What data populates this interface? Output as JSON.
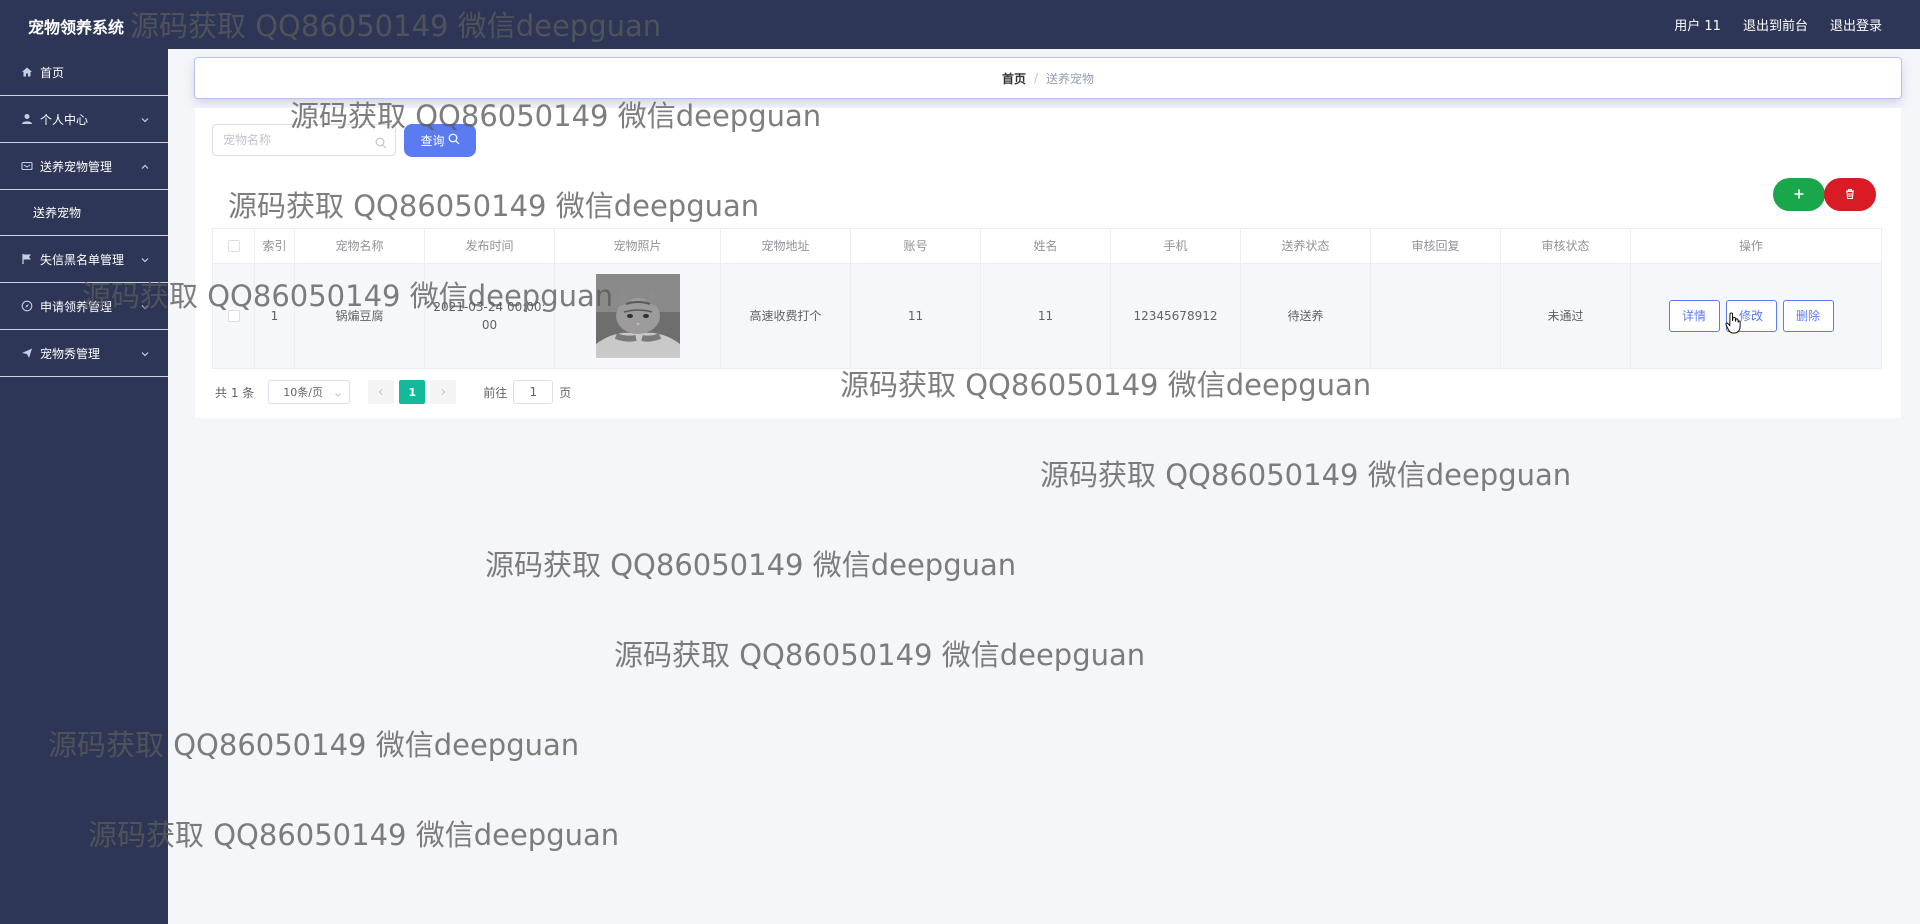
{
  "header": {
    "app_title": "宠物领养系统",
    "user_label": "用户 11",
    "to_front_label": "退出到前台",
    "logout_label": "退出登录"
  },
  "sidebar": {
    "items": [
      {
        "label": "首页",
        "icon": "home-icon"
      },
      {
        "label": "个人中心",
        "icon": "user-icon"
      },
      {
        "label": "送养宠物管理",
        "icon": "card-icon",
        "expanded": true
      },
      {
        "label": "送养宠物"
      },
      {
        "label": "失信黑名单管理",
        "icon": "flag-icon"
      },
      {
        "label": "申请领养管理",
        "icon": "compass-icon"
      },
      {
        "label": "宠物秀管理",
        "icon": "send-icon"
      }
    ]
  },
  "breadcrumb": {
    "home": "首页",
    "separator": "/",
    "current": "送养宠物"
  },
  "search": {
    "placeholder": "宠物名称",
    "value": "",
    "query_label": "查询"
  },
  "table": {
    "headers": [
      "",
      "索引",
      "宠物名称",
      "发布时间",
      "宠物照片",
      "宠物地址",
      "账号",
      "姓名",
      "手机",
      "送养状态",
      "审核回复",
      "审核状态",
      "操作"
    ],
    "rows": [
      {
        "index": "1",
        "pet_name": "锅煸豆腐",
        "publish_time": "2021-03-24 00:00:00",
        "photo": "cat-photo",
        "address": "高速收费打个",
        "account": "11",
        "name": "11",
        "phone": "12345678912",
        "adopt_status": "待送养",
        "review_reply": "",
        "review_status": "未通过",
        "actions": {
          "detail": "详情",
          "edit": "修改",
          "delete": "删除"
        }
      }
    ]
  },
  "pagination": {
    "total": "共 1 条",
    "page_size": "10条/页",
    "current_page": "1",
    "goto_prefix": "前往",
    "goto_value": "1",
    "goto_suffix": "页"
  },
  "watermark": "源码获取 QQ86050149 微信deepguan",
  "colors": {
    "nav_bg": "#2d3656",
    "primary": "#5b7cf0",
    "add": "#1aa64a",
    "delete": "#d81b25",
    "page_active": "#14b89a"
  }
}
